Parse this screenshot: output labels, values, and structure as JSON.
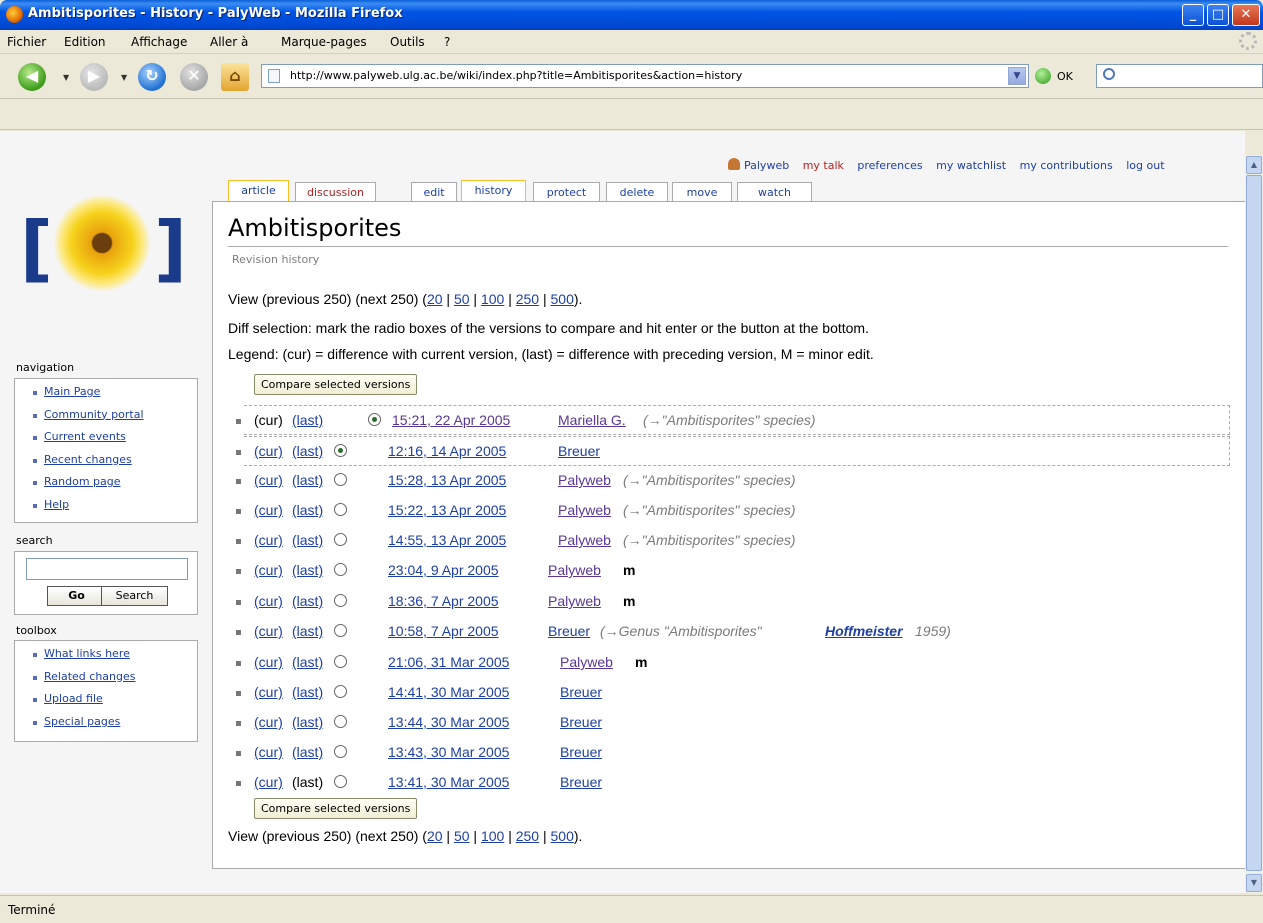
{
  "window": {
    "title": "Ambitisporites - History - PalyWeb - Mozilla Firefox",
    "minimize": "_",
    "maximize": "□",
    "close": "✕"
  },
  "menu": [
    "Fichier",
    "Edition",
    "Affichage",
    "Aller à",
    "Marque-pages",
    "Outils",
    "?"
  ],
  "toolbar": {
    "url": "http://www.palyweb.ulg.ac.be/wiki/index.php?title=Ambitisporites&action=history",
    "go_label": "OK",
    "search_value": ""
  },
  "personal": {
    "user": "Palyweb",
    "items": [
      "my talk",
      "preferences",
      "my watchlist",
      "my contributions",
      "log out"
    ]
  },
  "tabs": [
    "article",
    "discussion",
    "edit",
    "history",
    "protect",
    "delete",
    "move",
    "watch"
  ],
  "sidebar": {
    "navigation_title": "navigation",
    "navigation": [
      "Main Page",
      "Community portal",
      "Current events",
      "Recent changes",
      "Random page",
      "Help"
    ],
    "search_title": "search",
    "search_go": "Go",
    "search_btn": "Search",
    "toolbox_title": "toolbox",
    "toolbox": [
      "What links here",
      "Related changes",
      "Upload file",
      "Special pages"
    ]
  },
  "page": {
    "title": "Ambitisporites",
    "subtitle": "Revision history",
    "view_prefix": "View (previous 250) (next 250) (",
    "view_limits": [
      "20",
      "50",
      "100",
      "250",
      "500"
    ],
    "view_suffix": ").",
    "diff_help": "Diff selection: mark the radio boxes of the versions to compare and hit enter or the button at the bottom.",
    "legend": "Legend: (cur) = difference with current version, (last) = difference with preceding version, M = minor edit.",
    "compare_btn": "Compare selected versions"
  },
  "history": [
    {
      "cur": "(cur)",
      "last": "(last)",
      "date": "15:21, 22 Apr 2005",
      "user": "Mariella G.",
      "comment": "(→\"Ambitisporites\" species)",
      "minor": "",
      "radio": "on"
    },
    {
      "cur": "(cur)",
      "last": "(last)",
      "date": "12:16, 14 Apr 2005",
      "user": "Breuer",
      "comment": "",
      "minor": "",
      "radio": "on"
    },
    {
      "cur": "(cur)",
      "last": "(last)",
      "date": "15:28, 13 Apr 2005",
      "user": "Palyweb",
      "comment": "(→\"Ambitisporites\" species)",
      "minor": "",
      "radio": "off"
    },
    {
      "cur": "(cur)",
      "last": "(last)",
      "date": "15:22, 13 Apr 2005",
      "user": "Palyweb",
      "comment": "(→\"Ambitisporites\" species)",
      "minor": "",
      "radio": "off"
    },
    {
      "cur": "(cur)",
      "last": "(last)",
      "date": "14:55, 13 Apr 2005",
      "user": "Palyweb",
      "comment": "(→\"Ambitisporites\" species)",
      "minor": "",
      "radio": "off"
    },
    {
      "cur": "(cur)",
      "last": "(last)",
      "date": "23:04, 9 Apr 2005",
      "user": "Palyweb",
      "comment": "",
      "minor": "m",
      "radio": "off"
    },
    {
      "cur": "(cur)",
      "last": "(last)",
      "date": "18:36, 7 Apr 2005",
      "user": "Palyweb",
      "comment": "",
      "minor": "m",
      "radio": "off"
    },
    {
      "cur": "(cur)",
      "last": "(last)",
      "date": "10:58, 7 Apr 2005",
      "user": "Breuer",
      "comment": "(→Genus \"Ambitisporites\"",
      "comment_link": "Hoffmeister",
      "comment_tail": "1959)",
      "minor": "",
      "radio": "off"
    },
    {
      "cur": "(cur)",
      "last": "(last)",
      "date": "21:06, 31 Mar 2005",
      "user": "Palyweb",
      "comment": "",
      "minor": "m",
      "radio": "off"
    },
    {
      "cur": "(cur)",
      "last": "(last)",
      "date": "14:41, 30 Mar 2005",
      "user": "Breuer",
      "comment": "",
      "minor": "",
      "radio": "off"
    },
    {
      "cur": "(cur)",
      "last": "(last)",
      "date": "13:44, 30 Mar 2005",
      "user": "Breuer",
      "comment": "",
      "minor": "",
      "radio": "off"
    },
    {
      "cur": "(cur)",
      "last": "(last)",
      "date": "13:43, 30 Mar 2005",
      "user": "Breuer",
      "comment": "",
      "minor": "",
      "radio": "off"
    },
    {
      "cur": "(cur)",
      "last": "(last)",
      "date": "13:41, 30 Mar 2005",
      "user": "Breuer",
      "comment": "",
      "minor": "",
      "radio": "off"
    }
  ],
  "status": "Terminé"
}
